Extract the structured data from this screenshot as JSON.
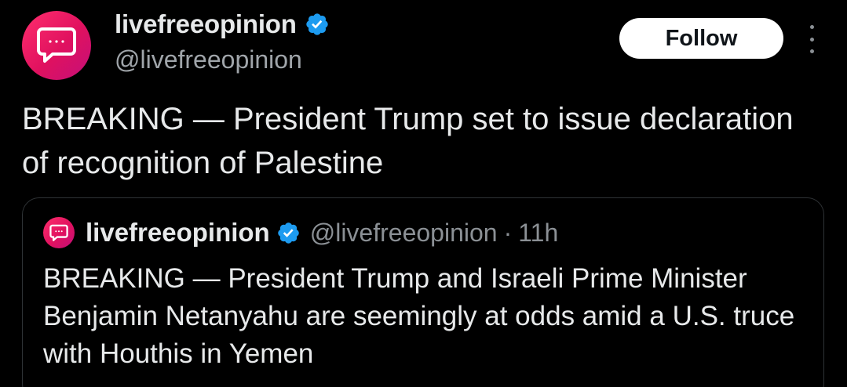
{
  "colors": {
    "background": "#000000",
    "text_primary": "#e7e9ea",
    "text_secondary": "#8b9095",
    "verified_badge": "#1d9bf0",
    "avatar_gradient": [
      "#ff2e6d",
      "#c4107a"
    ],
    "follow_bg": "#ffffff"
  },
  "author": {
    "display_name": "livefreeopinion",
    "handle": "@livefreeopinion",
    "avatar_icon": "speech-bubble-icon",
    "verified_icon": "verified-badge-icon"
  },
  "actions": {
    "follow_label": "Follow",
    "more_icon": "more-vertical-icon"
  },
  "tweet": {
    "text": "BREAKING — President Trump set to issue declaration of recognition of Palestine"
  },
  "quoted_tweet": {
    "display_name": "livefreeopinion",
    "handle": "@livefreeopinion",
    "separator": "·",
    "time": "11h",
    "text": "BREAKING — President Trump and Israeli Prime Minister Benjamin Netanyahu are seemingly at odds amid a U.S. truce with Houthis in Yemen"
  }
}
